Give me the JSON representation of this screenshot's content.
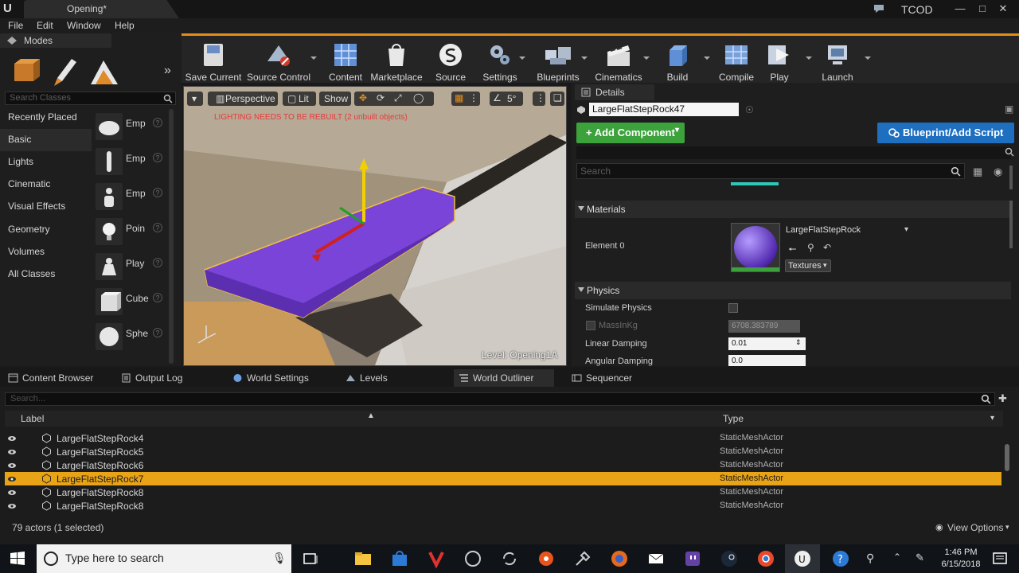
{
  "window": {
    "doc_tab": "Opening*",
    "project": "TCOD"
  },
  "menu": [
    "File",
    "Edit",
    "Window",
    "Help"
  ],
  "modes": {
    "tab_label": "Modes",
    "search_placeholder": "Search Classes",
    "categories": [
      "Recently Placed",
      "Basic",
      "Lights",
      "Cinematic",
      "Visual Effects",
      "Geometry",
      "Volumes",
      "All Classes"
    ],
    "active_category": "Basic",
    "items": [
      "Emp",
      "Emp",
      "Emp",
      "Poin",
      "Play",
      "Cube",
      "Sphe"
    ]
  },
  "toolbar": [
    {
      "label": "Save Current",
      "icon": "save-icon"
    },
    {
      "label": "Source Control",
      "icon": "source-control-icon"
    },
    {
      "label": "Content",
      "icon": "content-icon"
    },
    {
      "label": "Marketplace",
      "icon": "marketplace-icon"
    },
    {
      "label": "Source",
      "icon": "source-icon"
    },
    {
      "label": "Settings",
      "icon": "settings-icon"
    },
    {
      "label": "Blueprints",
      "icon": "blueprints-icon"
    },
    {
      "label": "Cinematics",
      "icon": "cinematics-icon"
    },
    {
      "label": "Build",
      "icon": "build-icon"
    },
    {
      "label": "Compile",
      "icon": "compile-icon"
    },
    {
      "label": "Play",
      "icon": "play-icon"
    },
    {
      "label": "Launch",
      "icon": "launch-icon"
    }
  ],
  "viewport": {
    "perspective": "Perspective",
    "lit": "Lit",
    "show": "Show",
    "snap_angle": "5°",
    "warning": "LIGHTING NEEDS TO BE REBUILT (2 unbuilt objects)",
    "level_label": "Level:  Opening1A"
  },
  "details": {
    "tab_label": "Details",
    "actor_name": "LargeFlatStepRock47",
    "add_component": "+ Add Component",
    "blueprint_script": "Blueprint/Add Script",
    "search_placeholder": "Search",
    "materials_section": "Materials",
    "element_label": "Element 0",
    "material_name": "LargeFlatStepRock",
    "textures_btn": "Textures",
    "physics_section": "Physics",
    "simulate_physics": "Simulate Physics",
    "mass_label": "MassInKg",
    "mass_value": "6708.383789",
    "linear_damping_label": "Linear Damping",
    "linear_damping_value": "0.01",
    "angular_damping_label": "Angular Damping",
    "angular_damping_value": "0.0"
  },
  "bottom_tabs": [
    "Content Browser",
    "Output Log",
    "World Settings",
    "Levels",
    "World Outliner",
    "Sequencer"
  ],
  "outliner": {
    "search_placeholder": "Search...",
    "col_label": "Label",
    "col_type": "Type",
    "rows": [
      {
        "label": "LargeFlatStepRock4",
        "type": "StaticMeshActor",
        "selected": false
      },
      {
        "label": "LargeFlatStepRock5",
        "type": "StaticMeshActor",
        "selected": false
      },
      {
        "label": "LargeFlatStepRock6",
        "type": "StaticMeshActor",
        "selected": false
      },
      {
        "label": "LargeFlatStepRock7",
        "type": "StaticMeshActor",
        "selected": true
      },
      {
        "label": "LargeFlatStepRock8",
        "type": "StaticMeshActor",
        "selected": false
      },
      {
        "label": "LargeFlatStepRock8",
        "type": "StaticMeshActor",
        "selected": false
      }
    ],
    "footer": "79 actors (1 selected)",
    "view_options": "View Options"
  },
  "taskbar": {
    "search_placeholder": "Type here to search",
    "time": "1:46 PM",
    "date": "6/15/2018"
  },
  "colors": {
    "accent_orange": "#e8a316",
    "add_component_green": "#3ca23c",
    "blueprint_blue": "#1f6fc1",
    "warning_red": "#e83a3a"
  }
}
